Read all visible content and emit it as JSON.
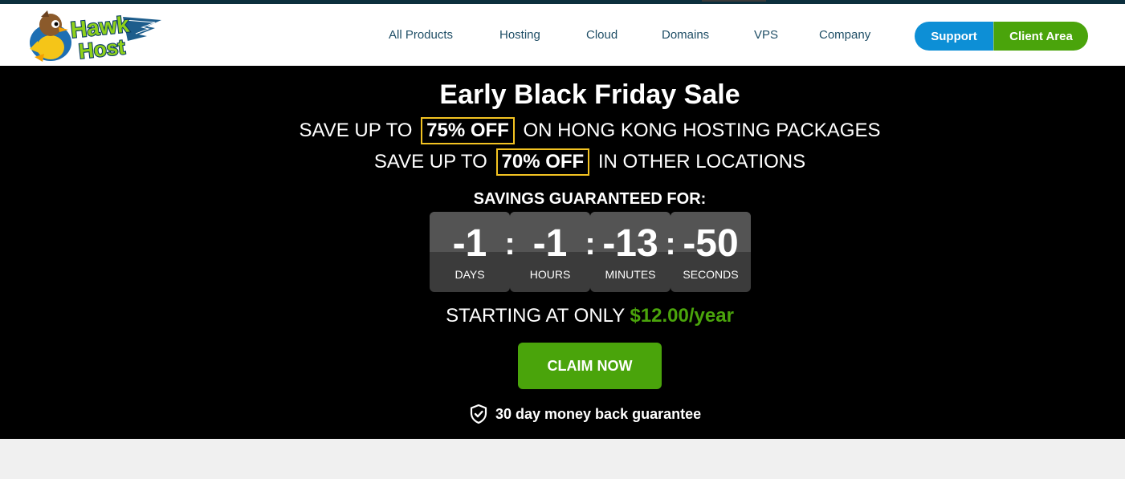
{
  "brand": {
    "logo_alt": "Hawk Host",
    "logo_word1": "Hawk",
    "logo_word2": "Host"
  },
  "nav": {
    "links": [
      "All Products",
      "Hosting",
      "Cloud",
      "Domains",
      "VPS",
      "Company"
    ],
    "support_label": "Support",
    "client_area_label": "Client Area"
  },
  "hero": {
    "title": "Early Black Friday Sale",
    "line1_prefix": "SAVE UP TO",
    "line1_badge": "75% OFF",
    "line1_suffix": "ON HONG KONG HOSTING PACKAGES",
    "line2_prefix": "SAVE UP TO",
    "line2_badge": "70% OFF",
    "line2_suffix": "IN OTHER LOCATIONS",
    "guarantee_label": "SAVINGS GUARANTEED FOR:",
    "countdown": {
      "days": "-1",
      "days_label": "DAYS",
      "hours": "-1",
      "hours_label": "HOURS",
      "minutes": "-13",
      "minutes_label": "MINUTES",
      "seconds": "-50",
      "seconds_label": "SECONDS",
      "separator": ":"
    },
    "starting_prefix": "STARTING AT ONLY",
    "starting_price": "$12.00/year",
    "cta_label": "CLAIM NOW",
    "money_back": "30 day money back guarantee"
  },
  "colors": {
    "accent_green": "#4aa40b",
    "accent_blue": "#0d8fd6",
    "badge_border": "#f3c322",
    "nav_text": "#1f4e66"
  },
  "icons": {
    "shield": "shield-check-icon"
  }
}
